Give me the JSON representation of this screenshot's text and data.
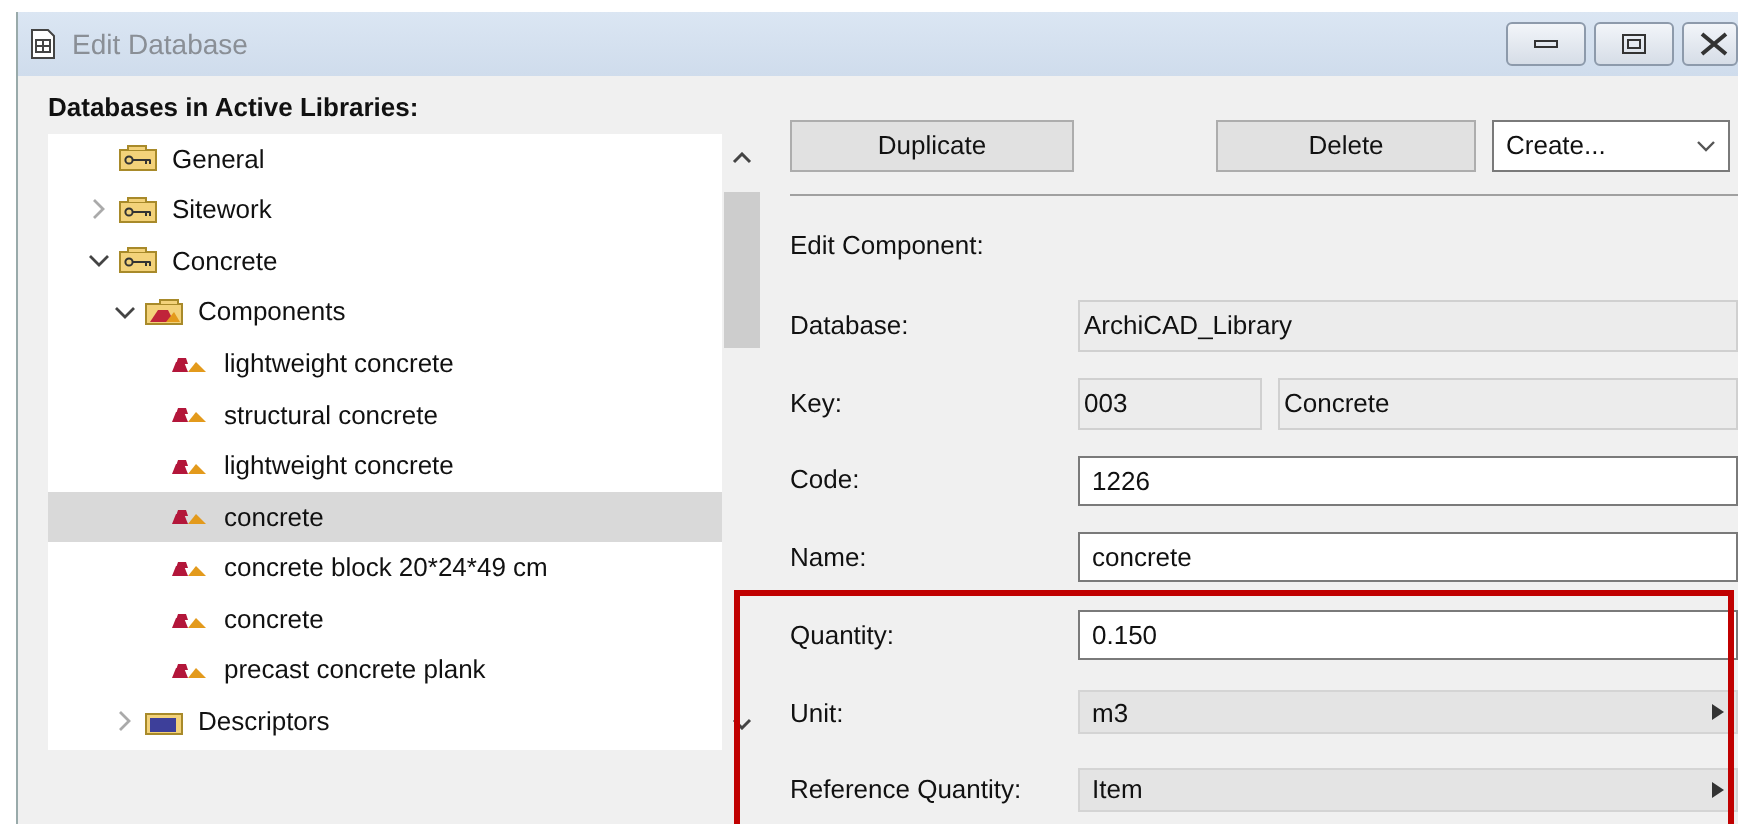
{
  "window": {
    "title": "Edit Database"
  },
  "tree": {
    "heading": "Databases in Active Libraries:",
    "nodes": [
      {
        "label": "General",
        "kind": "category",
        "selected": false
      },
      {
        "label": "Sitework",
        "kind": "category",
        "expanded": false,
        "selected": false
      },
      {
        "label": "Concrete",
        "kind": "category",
        "expanded": true,
        "selected": false,
        "children": [
          {
            "label": "Components",
            "kind": "group",
            "expanded": true,
            "selected": false,
            "children": [
              {
                "label": "lightweight concrete",
                "kind": "component",
                "selected": false
              },
              {
                "label": "structural concrete",
                "kind": "component",
                "selected": false
              },
              {
                "label": "lightweight concrete",
                "kind": "component",
                "selected": false
              },
              {
                "label": "concrete",
                "kind": "component",
                "selected": true
              },
              {
                "label": "concrete block 20*24*49 cm",
                "kind": "component",
                "selected": false
              },
              {
                "label": "concrete",
                "kind": "component",
                "selected": false
              },
              {
                "label": "precast concrete plank",
                "kind": "component",
                "selected": false
              }
            ]
          },
          {
            "label": "Descriptors",
            "kind": "descriptors",
            "expanded": false,
            "selected": false
          }
        ]
      }
    ]
  },
  "buttons": [
    "Duplicate",
    "Delete"
  ],
  "create_menu": {
    "value": "Create..."
  },
  "section_title": "Edit Component:",
  "fields": [
    {
      "label": "Database:",
      "kind": "readonly",
      "values": [
        "ArchiCAD_Library"
      ]
    },
    {
      "label": "Key:",
      "kind": "readonly",
      "values": [
        "003",
        "Concrete"
      ]
    },
    {
      "label": "Code:",
      "kind": "input",
      "values": [
        "1226"
      ]
    },
    {
      "label": "Name:",
      "kind": "input",
      "values": [
        "concrete"
      ]
    },
    {
      "label": "Quantity:",
      "kind": "input",
      "values": [
        "0.150"
      ]
    },
    {
      "label": "Unit:",
      "kind": "menu",
      "values": [
        "m3"
      ]
    },
    {
      "label": "Reference Quantity:",
      "kind": "menu",
      "values": [
        "Item"
      ]
    }
  ]
}
